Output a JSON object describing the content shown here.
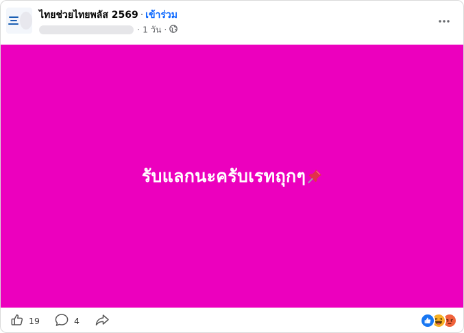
{
  "post": {
    "group_name": "ไทยช่วยไทยพลัส 2569",
    "separator": "·",
    "join_label": "เข้าร่วม",
    "time": "· 1 วัน ·",
    "privacy_icon": "globe-icon",
    "more_icon": "more-icon",
    "text": "รับแลกนะครับเรทถุกๆ",
    "text_emoji": "pushpin-icon",
    "background_color": "#ec00be"
  },
  "footer": {
    "like_count": "19",
    "comment_count": "4",
    "reactions": [
      "like-reaction-icon",
      "haha-reaction-icon",
      "angry-reaction-icon"
    ]
  }
}
